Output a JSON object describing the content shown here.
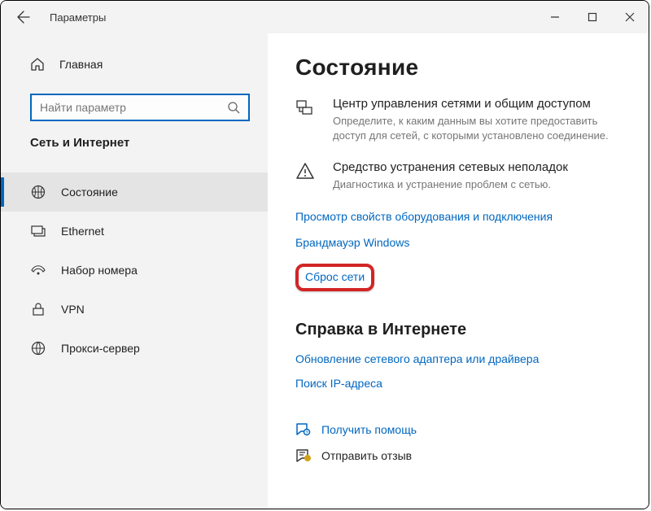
{
  "titlebar": {
    "title": "Параметры"
  },
  "sidebar": {
    "home_label": "Главная",
    "search_placeholder": "Найти параметр",
    "category": "Сеть и Интернет",
    "items": [
      {
        "label": "Состояние"
      },
      {
        "label": "Ethernet"
      },
      {
        "label": "Набор номера"
      },
      {
        "label": "VPN"
      },
      {
        "label": "Прокси-сервер"
      }
    ]
  },
  "main": {
    "page_title": "Состояние",
    "feature1": {
      "title": "Центр управления сетями и общим доступом",
      "desc": "Определите, к каким данным вы хотите предоставить доступ для сетей, с которыми установлено соединение."
    },
    "feature2": {
      "title": "Средство устранения сетевых неполадок",
      "desc": "Диагностика и устранение проблем с сетью."
    },
    "links": {
      "hw_props": "Просмотр свойств оборудования и подключения",
      "firewall": "Брандмауэр Windows",
      "reset": "Сброс сети"
    },
    "help_heading": "Справка в Интернете",
    "help": {
      "adapter": "Обновление сетевого адаптера или драйвера",
      "ip": "Поиск IP-адреса",
      "get_help": "Получить помощь",
      "feedback": "Отправить отзыв"
    }
  }
}
